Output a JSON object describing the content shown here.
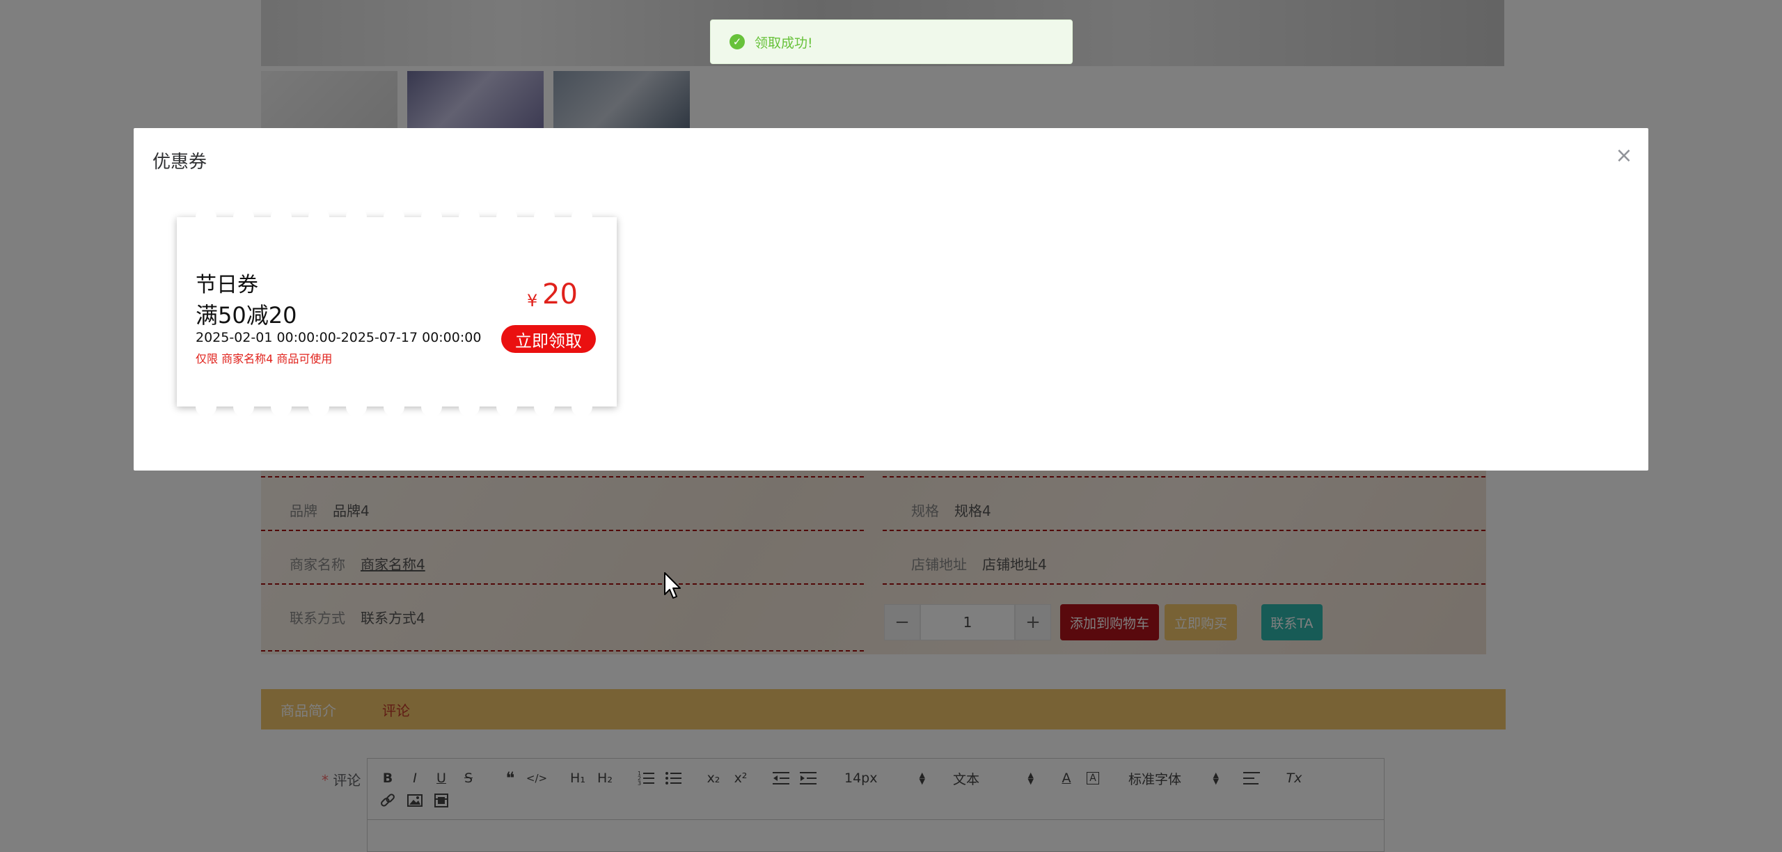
{
  "toast": {
    "icon": "success-check-icon",
    "message": "领取成功!"
  },
  "dialog": {
    "title": "优惠券",
    "close_icon": "close-icon",
    "coupon": {
      "name": "节日券",
      "rule": "满50减20",
      "validity": "2025-02-01 00:00:00-2025-07-17 00:00:00",
      "restriction": "仅限 商家名称4 商品可使用",
      "currency": "¥",
      "amount": "20",
      "claim_label": "立即领取"
    }
  },
  "product_info": {
    "brand_label": "品牌",
    "brand_value": "品牌4",
    "spec_label": "规格",
    "spec_value": "规格4",
    "merchant_label": "商家名称",
    "merchant_value": "商家名称4",
    "address_label": "店铺地址",
    "address_value": "店铺地址4",
    "contact_label": "联系方式",
    "contact_value": "联系方式4"
  },
  "purchase": {
    "quantity": "1",
    "minus": "−",
    "plus": "+",
    "add_to_cart": "添加到购物车",
    "buy_now": "立即购买",
    "contact_seller": "联系TA"
  },
  "tabs": [
    "商品简介",
    "评论"
  ],
  "comment": {
    "label": "评论",
    "required_mark": "*",
    "toolbar": {
      "bold": "B",
      "italic": "I",
      "underline": "U",
      "strike": "S",
      "h1": "H₁",
      "h2": "H₂",
      "sub": "x₂",
      "sup": "x²",
      "font_size": "14px",
      "text_type": "文本",
      "font_family": "标准字体",
      "clear": "Tx"
    }
  },
  "colors": {
    "toast_green": "#67c23a",
    "coupon_red": "#e0211b",
    "cart_button": "#b3121a",
    "buy_button": "#f0c46a",
    "contact_button": "#2fb6ad",
    "tab_bar": "#f0c46a"
  }
}
